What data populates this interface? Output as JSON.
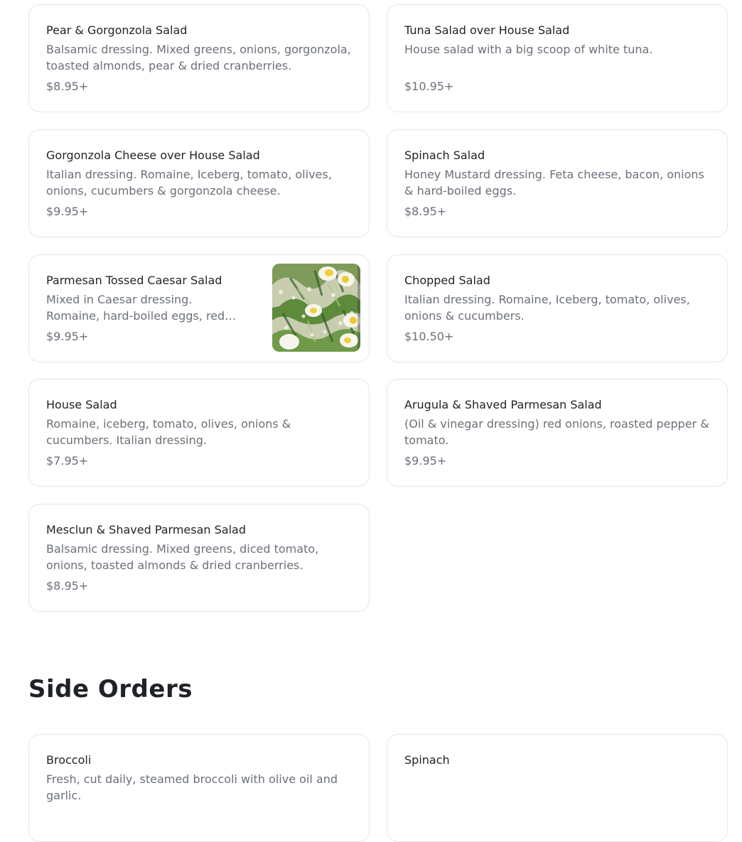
{
  "salads": [
    {
      "title": "Pear & Gorgonzola Salad",
      "description": "Balsamic dressing. Mixed greens, onions, gorgonzola, toasted almonds, pear & dried cranberries.",
      "price": "$8.95+"
    },
    {
      "title": "Tuna Salad over House Salad",
      "description": "House salad with a big scoop of white tuna.",
      "price": "$10.95+"
    },
    {
      "title": "Gorgonzola Cheese over House Salad",
      "description": "Italian dressing. Romaine, Iceberg, tomato, olives, onions, cucumbers & gorgonzola cheese.",
      "price": "$9.95+"
    },
    {
      "title": "Spinach Salad",
      "description": "Honey Mustard dressing. Feta cheese, bacon, onions & hard-boiled eggs.",
      "price": "$8.95+"
    },
    {
      "title": "Parmesan Tossed Caesar Salad",
      "description": "Mixed in Caesar dressing. Romaine, hard-boiled eggs, red…",
      "price": "$9.95+",
      "image": "caesar-salad-photo"
    },
    {
      "title": "Chopped Salad",
      "description": "Italian dressing. Romaine, Iceberg, tomato, olives, onions & cucumbers.",
      "price": "$10.50+"
    },
    {
      "title": "House Salad",
      "description": "Romaine, iceberg, tomato, olives, onions & cucumbers. Italian dressing.",
      "price": "$7.95+"
    },
    {
      "title": "Arugula & Shaved Parmesan Salad",
      "description": "(Oil & vinegar dressing) red onions, roasted pepper & tomato.",
      "price": "$9.95+"
    },
    {
      "title": "Mesclun & Shaved Parmesan Salad",
      "description": "Balsamic dressing. Mixed greens, diced tomato, onions, toasted almonds & dried cranberries.",
      "price": "$8.95+"
    }
  ],
  "side_orders": {
    "heading": "Side Orders",
    "items": [
      {
        "title": "Broccoli",
        "description": "Fresh, cut daily, steamed broccoli with olive oil and garlic."
      },
      {
        "title": "Spinach",
        "description": ""
      }
    ]
  },
  "colors": {
    "title_text": "#1f2226",
    "muted_text": "#6b7079",
    "card_border": "#e4e6e9",
    "background": "#ffffff"
  }
}
